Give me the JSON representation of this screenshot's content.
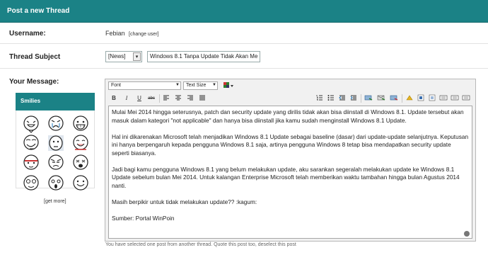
{
  "header": {
    "title": "Post a new Thread"
  },
  "username": {
    "label": "Username:",
    "value": "Febian",
    "change_link": "[change user]"
  },
  "subject": {
    "label": "Thread Subject",
    "prefix": "[News]",
    "value": "Windows 8.1 Tanpa Update Tidak Akan Me"
  },
  "message": {
    "label": "Your Message:"
  },
  "smilies": {
    "title": "Smilies",
    "get_more": "[get more]",
    "icons": [
      "smiley-laugh-icon",
      "smiley-cry-icon",
      "smiley-grin-icon",
      "smiley-troll-icon",
      "smiley-okay-icon",
      "smiley-happy-icon",
      "smiley-ninja-icon",
      "smiley-annoyed-icon",
      "smiley-sick-icon",
      "smiley-dizzy-icon",
      "smiley-shock-icon",
      "smiley-smile-icon"
    ]
  },
  "editor": {
    "font_placeholder": "Font",
    "size_placeholder": "Text Size",
    "paragraphs": [
      "Mulai Mei 2014 hingga seterusnya, patch dan security update yang dirilis tidak akan bisa diinstall di Windows 8.1. Update tersebut akan masuk dalam kategori \"not applicable\" dan hanya bisa diinstall jika kamu sudah menginstall Windows 8.1 Update.",
      "Hal ini dikarenakan Microsoft telah menjadikan Windows 8.1 Update sebagai baseline (dasar) dari update-update selanjutnya. Keputusan ini hanya berpengaruh kepada pengguna Windows 8.1 saja, artinya pengguna Windows 8 tetap bisa mendapatkan security update seperti biasanya.",
      "Jadi bagi kamu pengguna Windows 8.1 yang belum melakukan update, aku sarankan segeralah melakukan update ke Windows 8.1 Update sebelum bulan Mei 2014. Untuk kalangan Enterprise Microsoft telah memberikan waktu tambahan hingga bulan Agustus 2014 nanti.",
      "Masih berpikir untuk tidak melakukan update?? :kagum:",
      "Sumber: Portal WinPoin"
    ]
  },
  "footer": {
    "notice": "You have selected one post from another thread. Quote this post too, deselect this post"
  },
  "colors": {
    "accent": "#1b8286"
  }
}
